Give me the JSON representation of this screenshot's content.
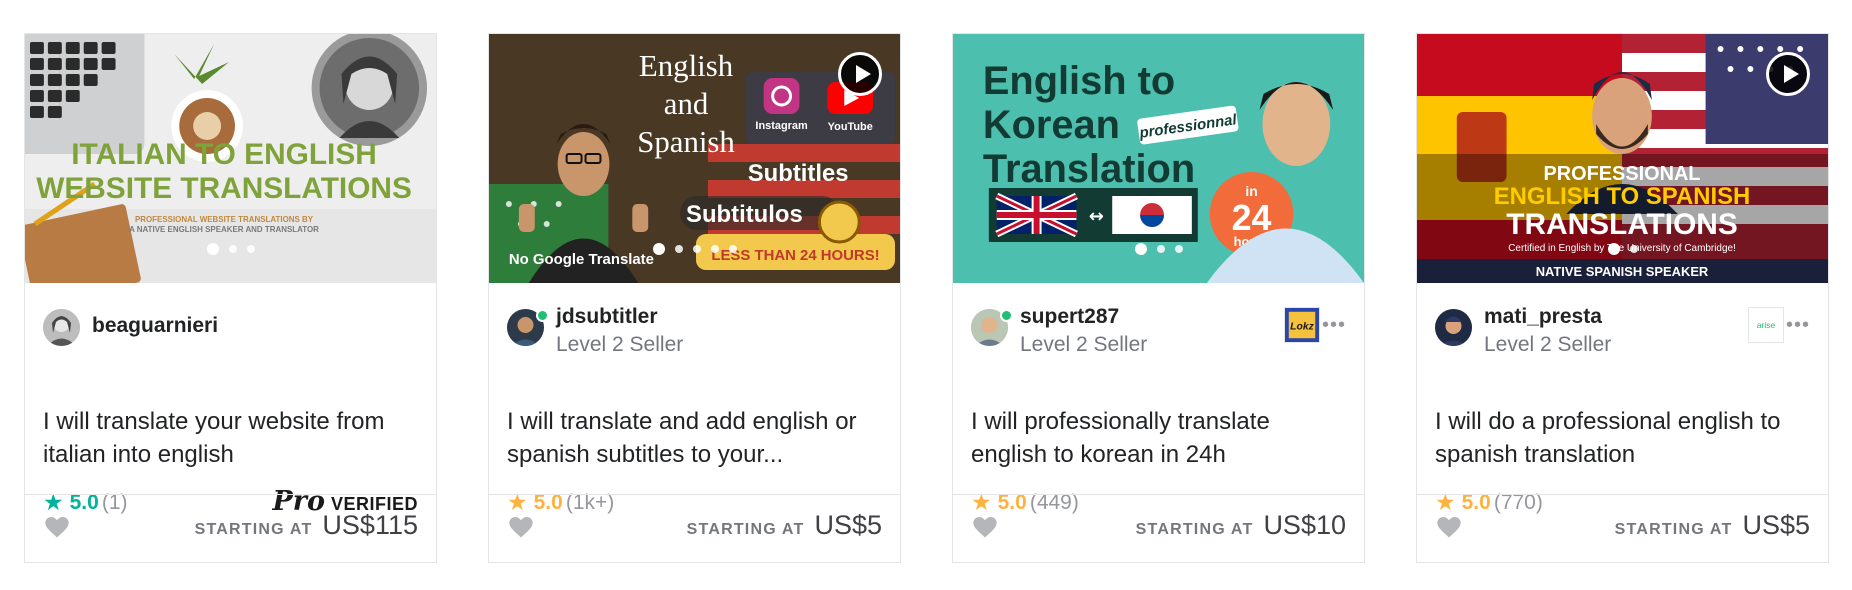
{
  "gigs": [
    {
      "seller_name": "beaguarnieri",
      "seller_level": "",
      "online": false,
      "title": "I will translate your website from italian into english",
      "rating": "5.0",
      "rating_count": "(1)",
      "star_color": "#00b39b",
      "badge": "pro",
      "pro_mark": "Pro",
      "pro_label": "VERIFIED",
      "starting_label": "STARTING AT",
      "price": "US$115",
      "has_video": false,
      "thumb": {
        "headline": [
          "ITALIAN TO ENGLISH",
          "WEBSITE TRANSLATIONS"
        ],
        "sub": [
          "PROFESSIONAL WEBSITE TRANSLATIONS BY",
          "A NATIVE ENGLISH SPEAKER AND TRANSLATOR"
        ]
      }
    },
    {
      "seller_name": "jdsubtitler",
      "seller_level": "Level 2 Seller",
      "online": true,
      "title": "I will translate and add english or spanish subtitles to your...",
      "rating": "5.0",
      "rating_count": "(1k+)",
      "star_color": "#ffb33e",
      "badge": "none",
      "starting_label": "STARTING AT",
      "price": "US$5",
      "has_video": true,
      "thumb": {
        "headline": [
          "English",
          "and",
          "Spanish"
        ],
        "subtitles": "Subtitles",
        "subtitulos": "Subtitulos",
        "instagram": "Instagram",
        "youtube": "YouTube",
        "no_google": "No Google Translate",
        "less_than": "LESS THAN 24 HOURS!"
      }
    },
    {
      "seller_name": "supert287",
      "seller_level": "Level 2 Seller",
      "online": true,
      "title": "I will professionally translate english to korean in 24h",
      "rating": "5.0",
      "rating_count": "(449)",
      "star_color": "#ffb33e",
      "badge": "brand",
      "badge_text": "Lokz",
      "starting_label": "STARTING AT",
      "price": "US$10",
      "has_video": false,
      "thumb": {
        "headline": [
          "English to",
          "Korean",
          "Translation"
        ],
        "tag": "professionnal",
        "circle_top": "in",
        "circle_big": "24",
        "circle_bottom": "hours"
      }
    },
    {
      "seller_name": "mati_presta",
      "seller_level": "Level 2 Seller",
      "online": false,
      "title": "I will do a professional english to spanish translation",
      "rating": "5.0",
      "rating_count": "(770)",
      "star_color": "#ffb33e",
      "badge": "brand",
      "badge_text": "arise",
      "starting_label": "STARTING AT",
      "price": "US$5",
      "has_video": true,
      "thumb": {
        "headline": [
          "PROFESSIONAL",
          "ENGLISH TO SPANISH",
          "TRANSLATIONS"
        ],
        "certified": "Certified in English by The University of Cambridge!",
        "native": "NATIVE SPANISH SPEAKER"
      }
    }
  ]
}
